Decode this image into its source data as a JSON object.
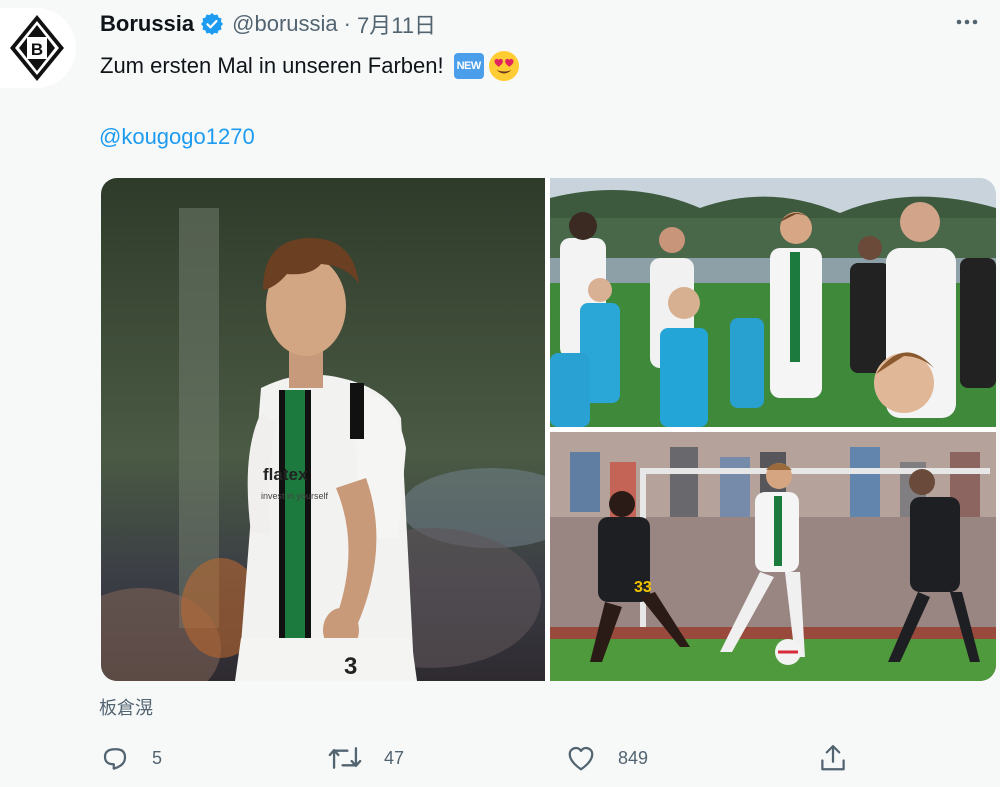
{
  "account": {
    "display_name": "Borussia",
    "handle": "@borussia",
    "separator": "·",
    "date": "7月11日",
    "verified": true
  },
  "tweet": {
    "text": "Zum ersten Mal in unseren Farben!",
    "new_badge": "NEW",
    "emoji": "heart-eyes",
    "mention": "@kougogo1270"
  },
  "media": {
    "photos": [
      {
        "subject": "player-portrait",
        "shirt_text": "flatex",
        "shirt_subtext": "invest in yourself",
        "number": "3"
      },
      {
        "subject": "players-walking-out-with-kids"
      },
      {
        "subject": "match-action",
        "opponent_number": "33"
      }
    ]
  },
  "caption": "板倉滉",
  "actions": {
    "replies": "5",
    "retweets": "47",
    "likes": "849"
  },
  "colors": {
    "link": "#1d9bf0",
    "verified": "#1d9bf0",
    "muted": "#536471",
    "background": "#f7f9f9"
  }
}
